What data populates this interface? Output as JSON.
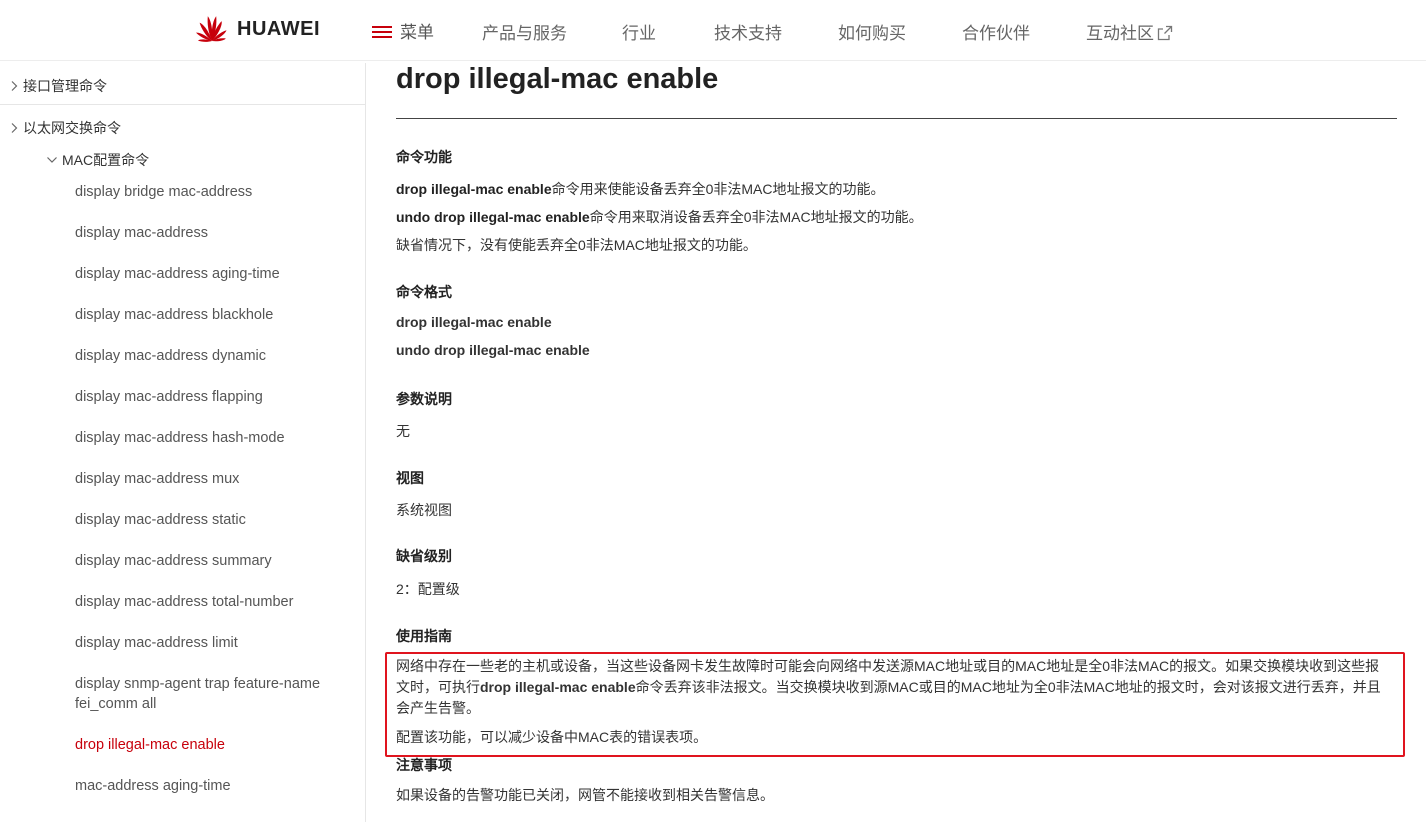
{
  "header": {
    "brand": "HUAWEI",
    "menu_label": "菜单",
    "nav": [
      "产品与服务",
      "行业",
      "技术支持",
      "如何购买",
      "合作伙伴",
      "互动社区"
    ],
    "brand_color": "#c7000b"
  },
  "sidebar": {
    "groups": [
      {
        "label": "接口管理命令",
        "state": "collapsed"
      },
      {
        "label": "以太网交换命令",
        "state": "expanded"
      },
      {
        "label": "MAC配置命令",
        "state": "expanded"
      }
    ],
    "items": [
      "display bridge mac-address",
      "display mac-address",
      "display mac-address aging-time",
      "display mac-address blackhole",
      "display mac-address dynamic",
      "display mac-address flapping",
      "display mac-address hash-mode",
      "display mac-address mux",
      "display mac-address static",
      "display mac-address summary",
      "display mac-address total-number",
      "display mac-address limit",
      "display snmp-agent trap feature-name fei_comm all",
      "drop illegal-mac enable",
      "mac-address aging-time"
    ],
    "active_item": "drop illegal-mac enable",
    "active_color": "#c7000b"
  },
  "doc": {
    "title": "drop illegal-mac enable",
    "sections": {
      "function": {
        "heading": "命令功能",
        "line1_cmd": "drop illegal-mac enable",
        "line1_text": "命令用来使能设备丢弃全0非法MAC地址报文的功能。",
        "line2_cmd": "undo drop illegal-mac enable",
        "line2_text": "命令用来取消设备丢弃全0非法MAC地址报文的功能。",
        "line3": "缺省情况下，没有使能丢弃全0非法MAC地址报文的功能。"
      },
      "format": {
        "heading": "命令格式",
        "cmd1": "drop illegal-mac enable",
        "cmd2": "undo drop illegal-mac enable"
      },
      "params": {
        "heading": "参数说明",
        "text": "无"
      },
      "view": {
        "heading": "视图",
        "text": "系统视图"
      },
      "level": {
        "heading": "缺省级别",
        "text": "2：配置级"
      },
      "guide": {
        "heading": "使用指南",
        "p1_before": "网络中存在一些老的主机或设备，当这些设备网卡发生故障时可能会向网络中发送源MAC地址或目的MAC地址是全0非法MAC的报文。如果交换模块收到这些报文时，可执行",
        "p1_cmd": "drop illegal-mac enable",
        "p1_after": "命令丢弃该非法报文。当交换模块收到源MAC或目的MAC地址为全0非法MAC地址的报文时，会对该报文进行丢弃，并且会产生告警。",
        "p2": "配置该功能，可以减少设备中MAC表的错误表项。",
        "highlight_color": "#e0141e"
      },
      "notes": {
        "heading": "注意事项",
        "text": "如果设备的告警功能已关闭，网管不能接收到相关告警信息。"
      }
    }
  }
}
